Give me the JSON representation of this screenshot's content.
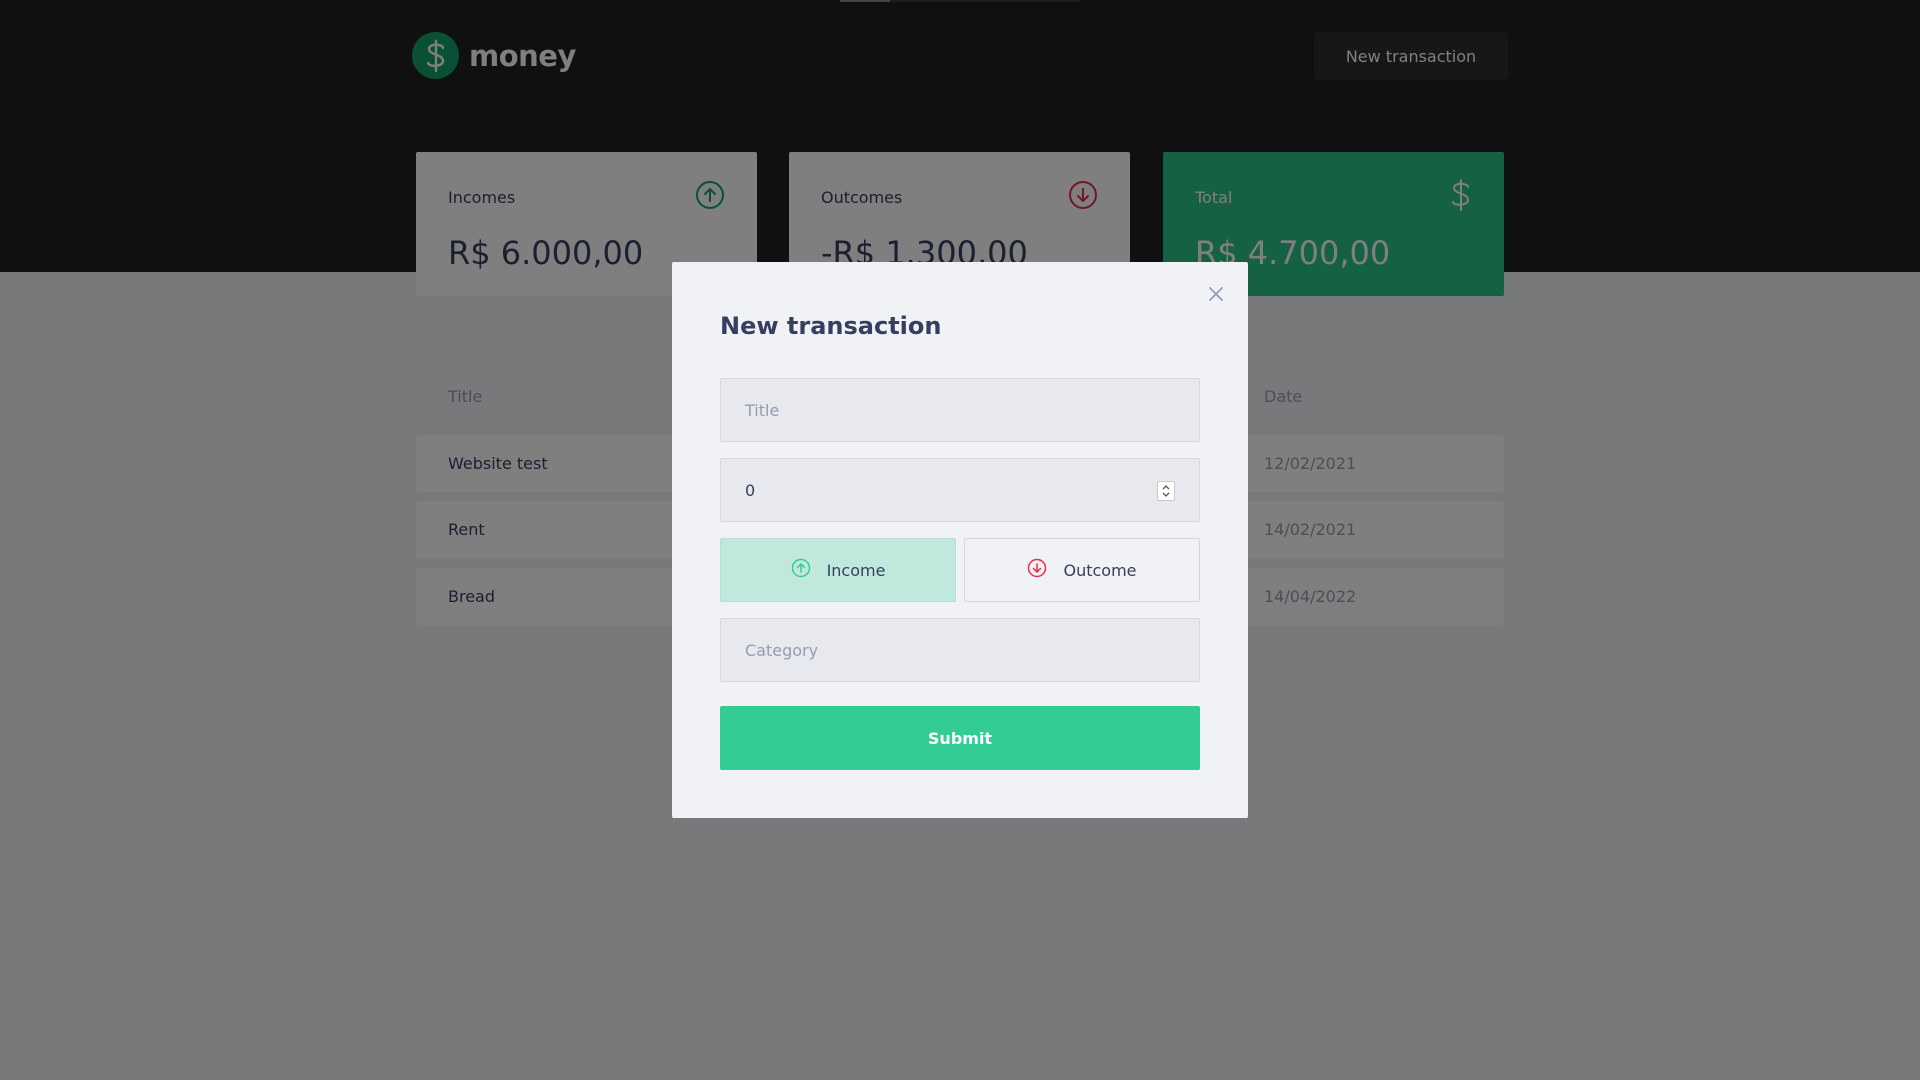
{
  "app": {
    "brand": "money",
    "new_transaction_button": "New transaction"
  },
  "summary": {
    "incomes": {
      "label": "Incomes",
      "value": "R$ 6.000,00"
    },
    "outcomes": {
      "label": "Outcomes",
      "value": "-R$ 1.300,00"
    },
    "total": {
      "label": "Total",
      "value": "R$ 4.700,00"
    }
  },
  "table": {
    "headers": {
      "title": "Title",
      "date": "Date"
    },
    "rows": [
      {
        "title": "Website test",
        "date": "12/02/2021"
      },
      {
        "title": "Rent",
        "date": "14/02/2021"
      },
      {
        "title": "Bread",
        "date": "14/04/2022"
      }
    ]
  },
  "modal": {
    "title": "New transaction",
    "title_placeholder": "Title",
    "amount_value": "0",
    "income_label": "Income",
    "outcome_label": "Outcome",
    "category_placeholder": "Category",
    "submit_label": "Submit"
  },
  "colors": {
    "header_bg": "#202024",
    "green": "#33cc95",
    "red": "#e52e4d",
    "total_card": "#28c386"
  },
  "icons": {
    "logo": "dollar-circle-icon",
    "income": "arrow-up-circle-icon",
    "outcome": "arrow-down-circle-icon",
    "total": "dollar-icon",
    "close": "close-icon"
  }
}
